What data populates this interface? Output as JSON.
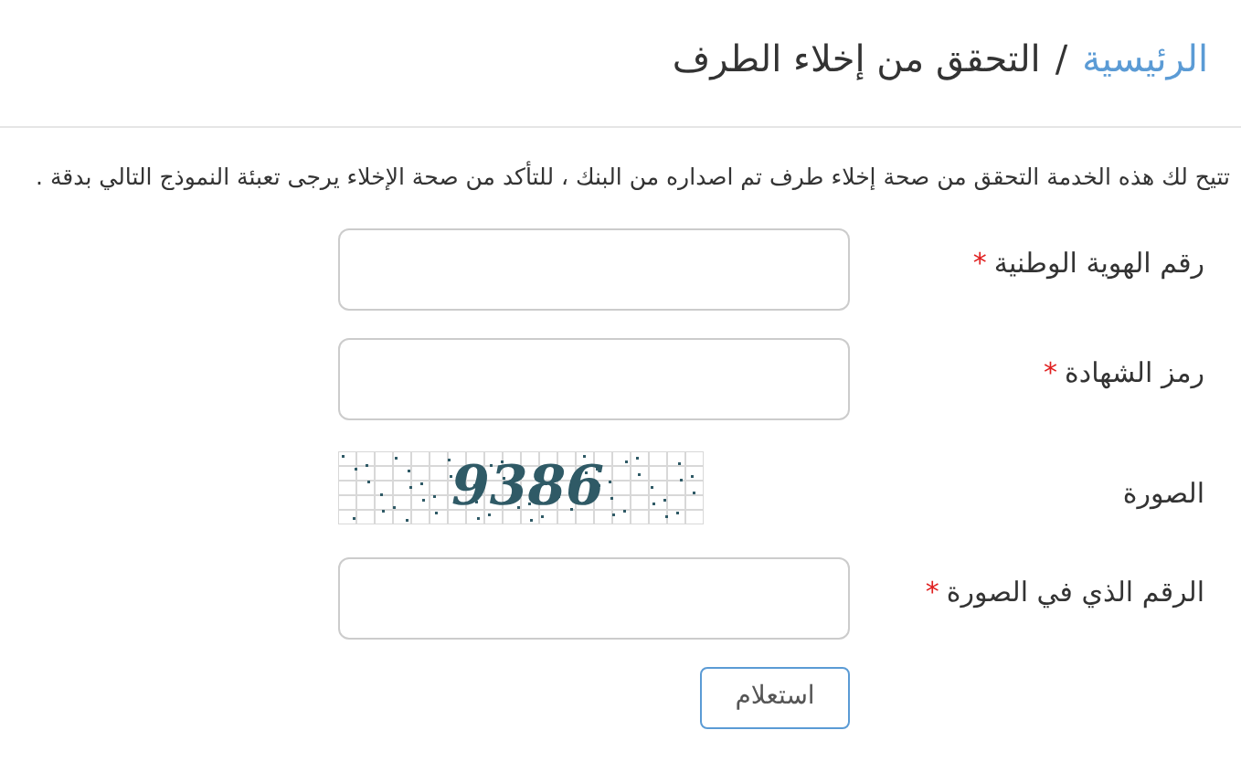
{
  "breadcrumb": {
    "home": "الرئيسية",
    "separator": "/",
    "current": "التحقق من إخلاء الطرف"
  },
  "description": "تتيح لك هذه الخدمة التحقق من صحة إخلاء طرف تم اصداره من البنك ، للتأكد من صحة الإخلاء يرجى تعبئة النموذج التالي بدقة .",
  "fields": [
    {
      "kind": "input",
      "label": "رقم الهوية الوطنية",
      "required_mark": "*"
    },
    {
      "kind": "input",
      "label": "رمز الشهادة",
      "required_mark": "*"
    },
    {
      "kind": "captcha",
      "label": "الصورة",
      "code": "9386"
    },
    {
      "kind": "input",
      "label": "الرقم الذي في الصورة",
      "required_mark": "*"
    }
  ],
  "submit": "استعلام"
}
